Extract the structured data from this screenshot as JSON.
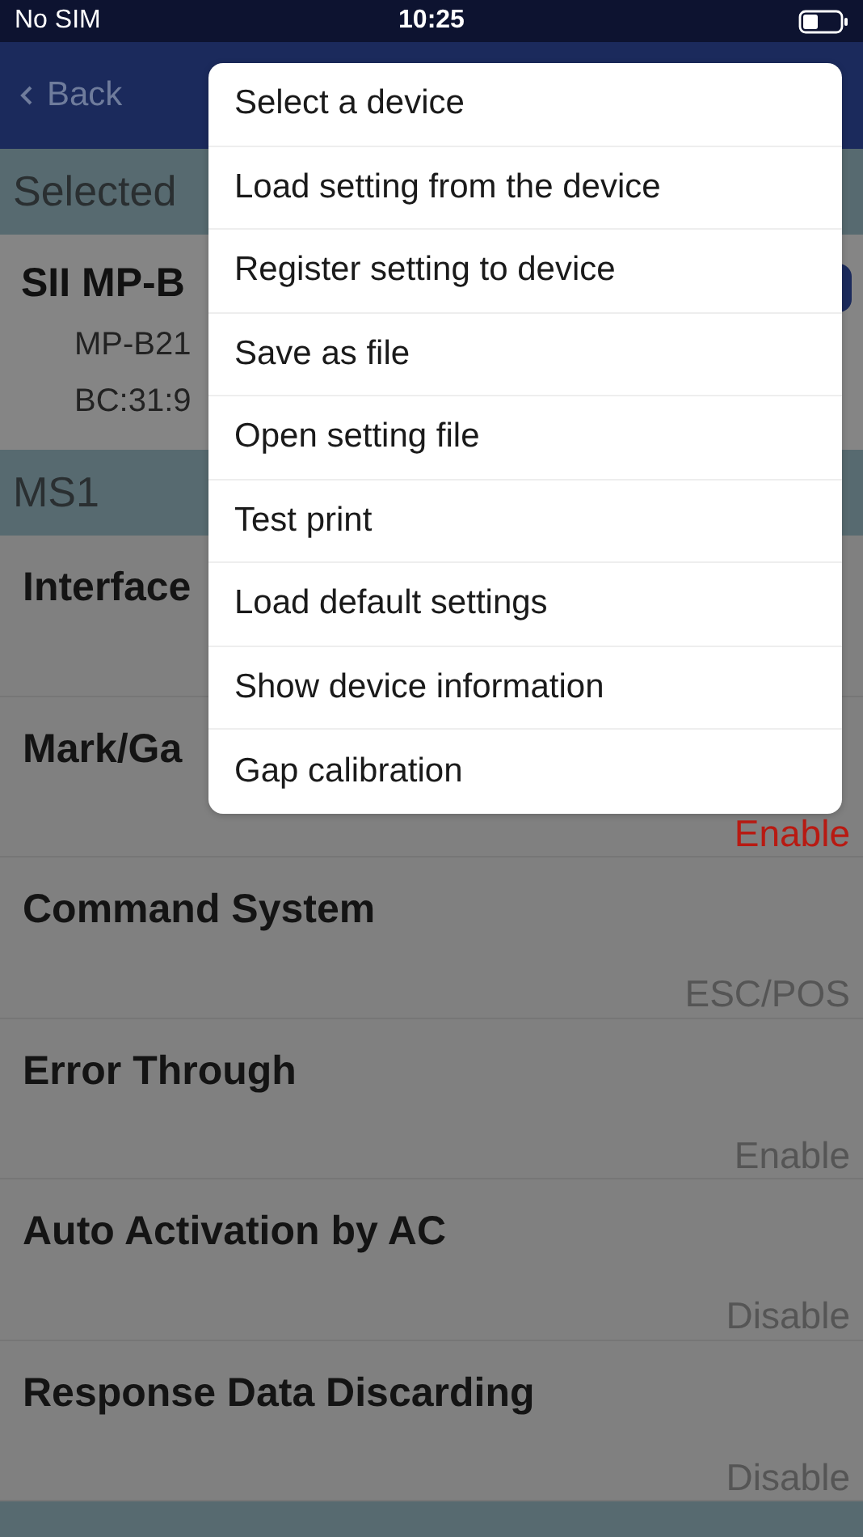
{
  "status_bar": {
    "carrier": "No SIM",
    "time": "10:25"
  },
  "nav": {
    "back": "Back"
  },
  "selected_header": "Selected",
  "device": {
    "name": "SII MP-B",
    "model": "MP-B21",
    "address": "BC:31:9"
  },
  "sections": [
    {
      "title": "MS1",
      "rows": [
        {
          "label": "Interface"
        },
        {
          "label": "Mark/Ga",
          "value": "Enable",
          "alert": true
        },
        {
          "label": "Command System",
          "value": "ESC/POS",
          "alert": false
        },
        {
          "label": "Error Through",
          "value": "Enable",
          "alert": false
        },
        {
          "label": "Auto Activation by AC",
          "value": "Disable",
          "alert": false
        },
        {
          "label": "Response Data Discarding",
          "value": "Disable",
          "alert": false
        }
      ]
    }
  ],
  "menu": {
    "items": [
      "Select a device",
      "Load setting from the device",
      "Register setting to device",
      "Save as file",
      "Open setting file",
      "Test print",
      "Load default settings",
      "Show device information",
      "Gap calibration"
    ]
  }
}
